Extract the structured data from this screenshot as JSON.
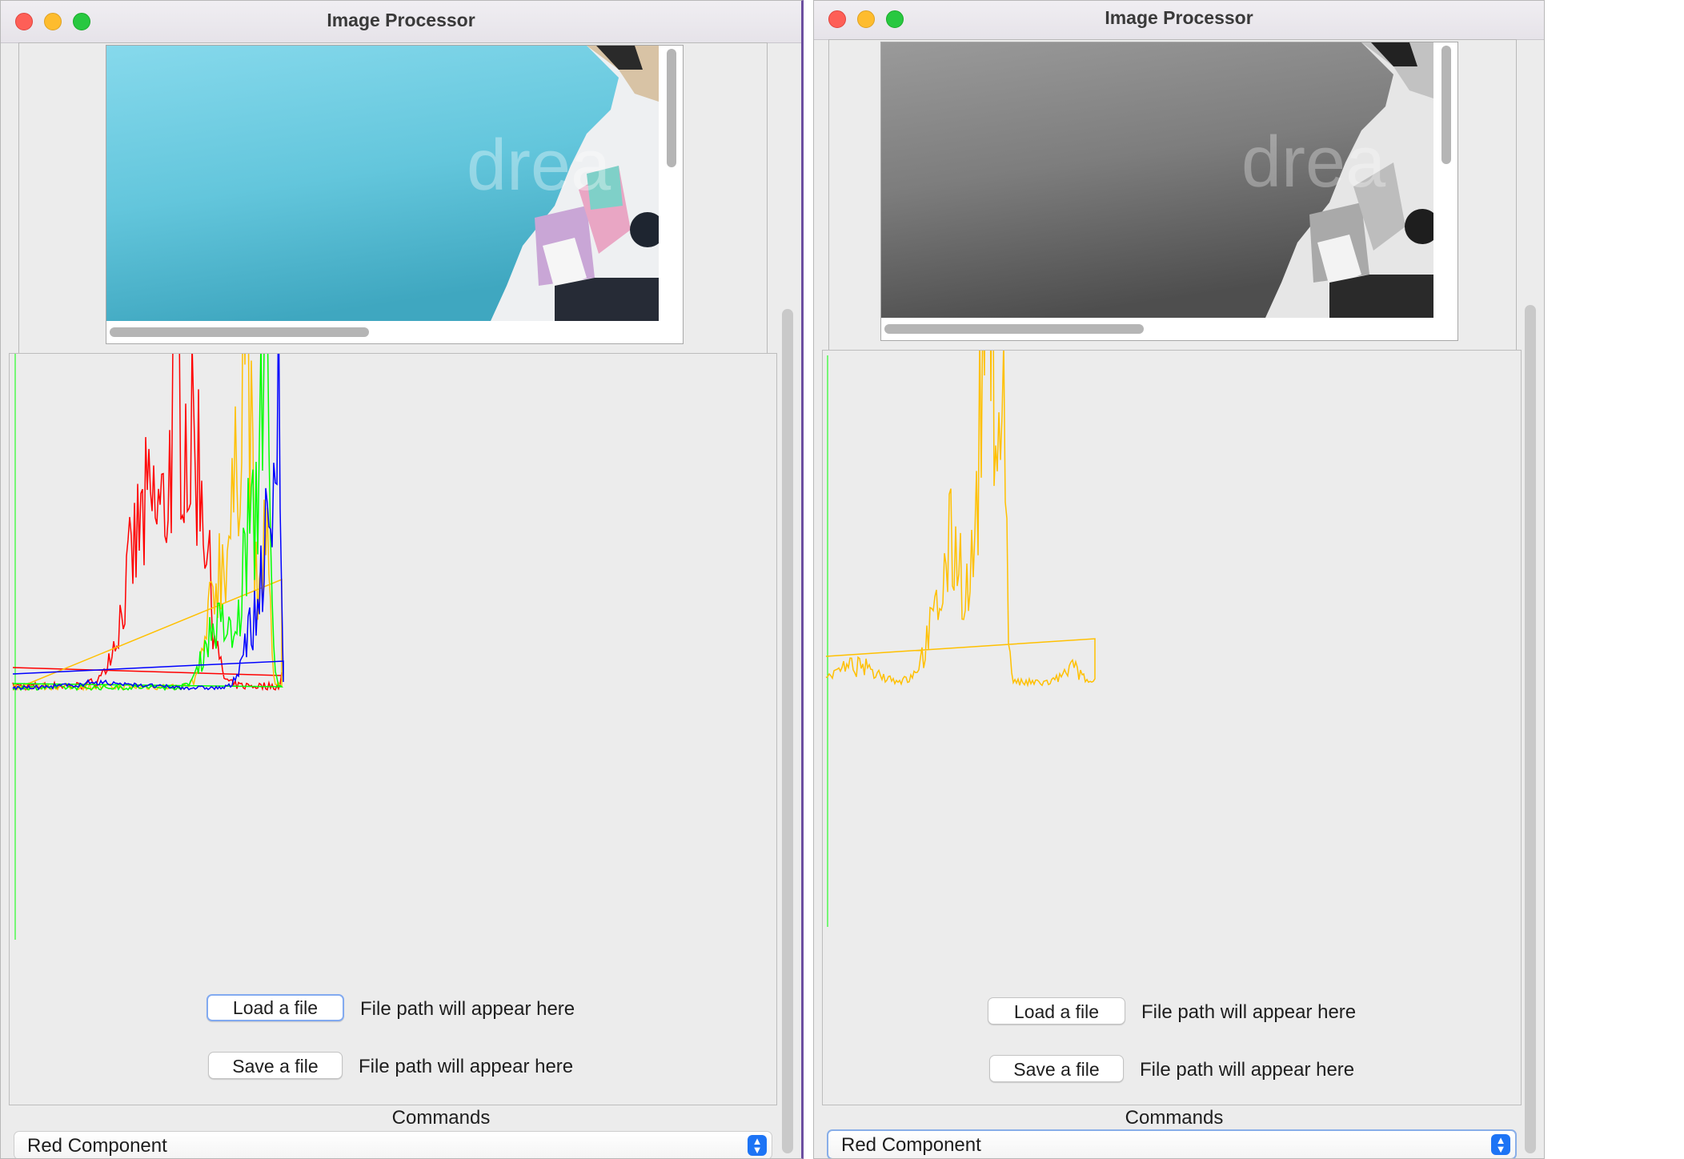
{
  "windows": [
    {
      "id": "left",
      "title": "Image Processor",
      "image_mode": "color",
      "image_watermark": "drea",
      "load_button": "Load a file",
      "load_path": "File path will appear here",
      "save_button": "Save a file",
      "save_path": "File path will appear here",
      "commands_label": "Commands",
      "command_selected": "Red Component",
      "histogram_series": [
        "red",
        "green",
        "blue",
        "intensity"
      ]
    },
    {
      "id": "right",
      "title": "Image Processor",
      "image_mode": "grayscale",
      "image_watermark": "drea",
      "load_button": "Load a file",
      "load_path": "File path will appear here",
      "save_button": "Save a file",
      "save_path": "File path will appear here",
      "commands_label": "Commands",
      "command_selected": "Red Component",
      "histogram_series": [
        "intensity"
      ]
    }
  ],
  "colors": {
    "red": "#ff0000",
    "green": "#00ff00",
    "blue": "#0000ff",
    "intensity": "#ffc000",
    "sky": "#6ccde0",
    "accent": "#1d74f5"
  },
  "icons": [
    "close-icon",
    "minimize-icon",
    "maximize-icon",
    "chevron-updown-icon"
  ]
}
